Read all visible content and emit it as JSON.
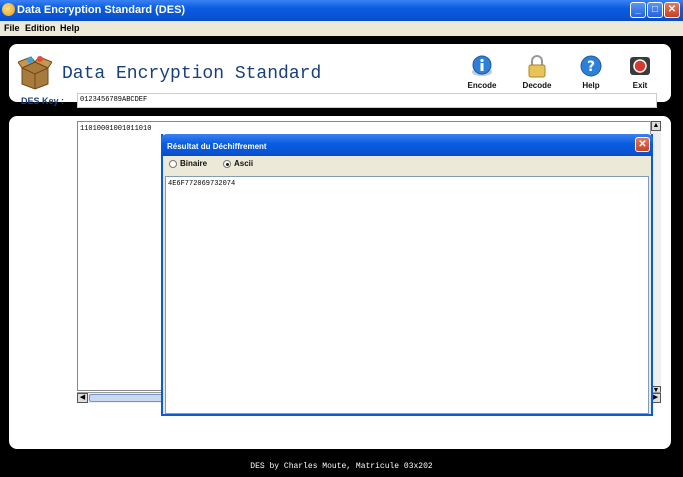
{
  "window": {
    "title": "Data Encryption Standard (DES)",
    "minimize": "_",
    "maximize": "□",
    "close": "✕"
  },
  "menu": {
    "items": [
      "File",
      "Edition",
      "Help"
    ]
  },
  "header": {
    "title": "Data Encryption Standard",
    "logo_icon": "box-logo-icon"
  },
  "toolbar": {
    "encode": {
      "label": "Encode",
      "icon": "info-icon"
    },
    "decode": {
      "label": "Decode",
      "icon": "padlock-icon"
    },
    "help": {
      "label": "Help",
      "icon": "help-icon"
    },
    "exit": {
      "label": "Exit",
      "icon": "exit-icon"
    }
  },
  "form": {
    "key_label": "DES Key :",
    "key_value": "0123456789ABCDEF",
    "binary_text": "11010001001011010"
  },
  "dialog": {
    "title": "Résultat du Déchiffrement",
    "close": "✕",
    "options": [
      {
        "label": "Binaire",
        "selected": false
      },
      {
        "label": "Ascii",
        "selected": true
      }
    ],
    "result": "4E6F772069732074"
  },
  "status": "DES by Charles Moute, Matricule 03x202",
  "colors": {
    "title_bar": "#0a5ce0",
    "accent": "#17407b",
    "background": "#000000"
  }
}
